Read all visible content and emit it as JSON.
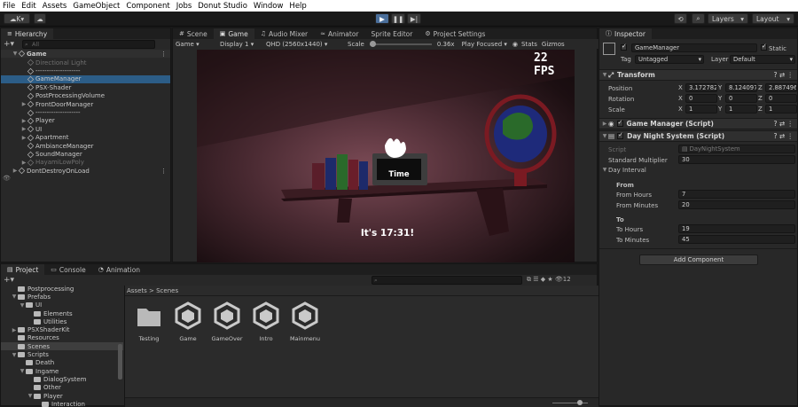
{
  "menu": [
    "File",
    "Edit",
    "Assets",
    "GameObject",
    "Component",
    "Jobs",
    "Donut Studio",
    "Window",
    "Help"
  ],
  "toolbar": {
    "account": "K",
    "layers": "Layers",
    "layout": "Layout"
  },
  "hierarchy": {
    "title": "Hierarchy",
    "search_placeholder": "All",
    "scene": "Game",
    "items": [
      {
        "label": "Directional Light",
        "dim": true,
        "indent": 1,
        "arrow": ""
      },
      {
        "label": "--------------------",
        "dim": false,
        "indent": 1,
        "arrow": ""
      },
      {
        "label": "GameManager",
        "dim": false,
        "indent": 1,
        "arrow": "",
        "sel": true
      },
      {
        "label": "PSX-Shader",
        "dim": false,
        "indent": 1,
        "arrow": ""
      },
      {
        "label": "PostProcessingVolume",
        "dim": false,
        "indent": 1,
        "arrow": ""
      },
      {
        "label": "FrontDoorManager",
        "dim": false,
        "indent": 1,
        "arrow": "▶"
      },
      {
        "label": "--------------------",
        "dim": false,
        "indent": 1,
        "arrow": ""
      },
      {
        "label": "Player",
        "dim": false,
        "indent": 1,
        "arrow": "▶"
      },
      {
        "label": "UI",
        "dim": false,
        "indent": 1,
        "arrow": "▶"
      },
      {
        "label": "Apartment",
        "dim": false,
        "indent": 1,
        "arrow": "▶"
      },
      {
        "label": "AmbianceManager",
        "dim": false,
        "indent": 1,
        "arrow": ""
      },
      {
        "label": "SoundManager",
        "dim": false,
        "indent": 1,
        "arrow": ""
      },
      {
        "label": "HayamiLowPoly",
        "dim": true,
        "indent": 1,
        "arrow": "▶"
      },
      {
        "label": "DontDestroyOnLoad",
        "dim": false,
        "indent": 0,
        "arrow": "▶"
      }
    ]
  },
  "scene_tabs": [
    {
      "label": "Scene",
      "icon": "#"
    },
    {
      "label": "Game",
      "icon": "▣",
      "sel": true
    },
    {
      "label": "Audio Mixer",
      "icon": "♫"
    },
    {
      "label": "Animator",
      "icon": "≈"
    },
    {
      "label": "Sprite Editor",
      "icon": ""
    },
    {
      "label": "Project Settings",
      "icon": "⚙"
    }
  ],
  "game_bar": {
    "display_mode": "Game",
    "display": "Display 1",
    "resolution": "QHD (2560x1440)",
    "scale_label": "Scale",
    "scale_value": "0.36x",
    "play_mode": "Play Focused",
    "stats": "Stats",
    "gizmos": "Gizmos"
  },
  "game_view": {
    "fps": "22 FPS",
    "time_label": "Time",
    "clock_text": "It's 17:31!"
  },
  "inspector": {
    "title": "Inspector",
    "object_name": "GameManager",
    "static_label": "Static",
    "tag_label": "Tag",
    "tag_value": "Untagged",
    "layer_label": "Layer",
    "layer_value": "Default",
    "transform": {
      "title": "Transform",
      "rows": [
        {
          "label": "Position",
          "x": "3.172782",
          "y": "8.124097",
          "z": "2.887496"
        },
        {
          "label": "Rotation",
          "x": "0",
          "y": "0",
          "z": "0"
        },
        {
          "label": "Scale",
          "x": "1",
          "y": "1",
          "z": "1"
        }
      ]
    },
    "game_manager": {
      "title": "Game Manager (Script)"
    },
    "day_night": {
      "title": "Day Night System (Script)",
      "script_label": "Script",
      "script_value": "DayNightSystem",
      "multiplier_label": "Standard Multiplier",
      "multiplier_value": "30",
      "interval_label": "Day Interval",
      "from_label": "From",
      "from_hours_label": "From Hours",
      "from_hours": "7",
      "from_minutes_label": "From Minutes",
      "from_minutes": "20",
      "to_label": "To",
      "to_hours_label": "To Hours",
      "to_hours": "19",
      "to_minutes_label": "To Minutes",
      "to_minutes": "45"
    },
    "add_component": "Add Component"
  },
  "bottom_tabs": [
    {
      "label": "Project",
      "sel": true,
      "icon": "▤"
    },
    {
      "label": "Console",
      "icon": "▭"
    },
    {
      "label": "Animation",
      "icon": "◔"
    }
  ],
  "project": {
    "hidden_count": "12",
    "folders": [
      {
        "label": "Postprocessing",
        "indent": 1,
        "arrow": ""
      },
      {
        "label": "Prefabs",
        "indent": 1,
        "arrow": "▼"
      },
      {
        "label": "UI",
        "indent": 2,
        "arrow": "▼"
      },
      {
        "label": "Elements",
        "indent": 3,
        "arrow": ""
      },
      {
        "label": "Utilities",
        "indent": 3,
        "arrow": ""
      },
      {
        "label": "PSXShaderKit",
        "indent": 1,
        "arrow": "▶"
      },
      {
        "label": "Resources",
        "indent": 1,
        "arrow": ""
      },
      {
        "label": "Scenes",
        "indent": 1,
        "arrow": "",
        "sel": true
      },
      {
        "label": "Scripts",
        "indent": 1,
        "arrow": "▼"
      },
      {
        "label": "Death",
        "indent": 2,
        "arrow": ""
      },
      {
        "label": "Ingame",
        "indent": 2,
        "arrow": "▼"
      },
      {
        "label": "DialogSystem",
        "indent": 3,
        "arrow": ""
      },
      {
        "label": "Other",
        "indent": 3,
        "arrow": ""
      },
      {
        "label": "Player",
        "indent": 3,
        "arrow": "▼"
      },
      {
        "label": "Interaction",
        "indent": 4,
        "arrow": ""
      }
    ],
    "breadcrumb": [
      "Assets",
      "Scenes"
    ],
    "assets": [
      {
        "label": "Testing",
        "type": "folder"
      },
      {
        "label": "Game",
        "type": "scene"
      },
      {
        "label": "GameOver",
        "type": "scene"
      },
      {
        "label": "Intro",
        "type": "scene"
      },
      {
        "label": "Mainmenu",
        "type": "scene"
      }
    ]
  },
  "colors": {
    "selection": "#2c5d87",
    "panel": "#282828",
    "accent_play": "#4a6e9a"
  }
}
